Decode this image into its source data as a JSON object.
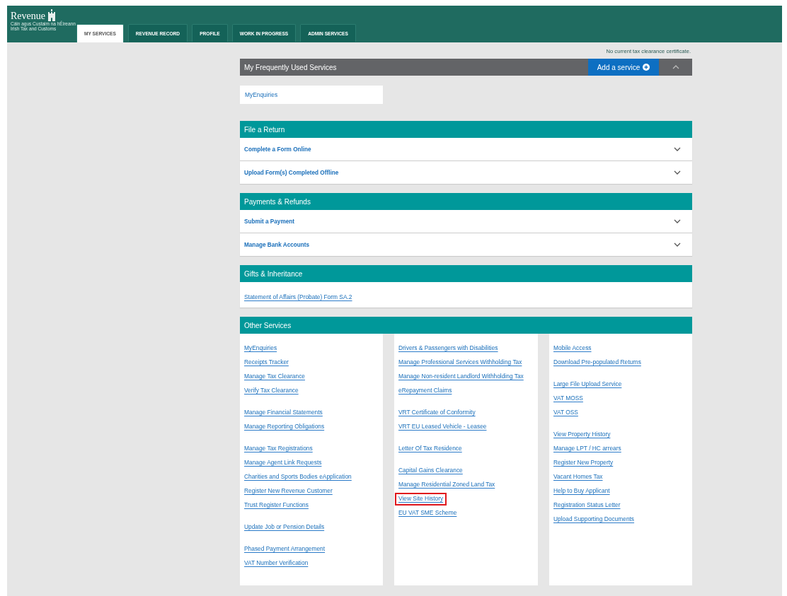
{
  "header": {
    "logo": {
      "name": "Revenue",
      "subtitle_1": "Cáin agus Custaim na hÉireann",
      "subtitle_2": "Irish Tax and Customs"
    },
    "tabs": [
      {
        "label": "MY SERVICES",
        "selected": true
      },
      {
        "label": "REVENUE RECORD",
        "selected": false
      },
      {
        "label": "PROFILE",
        "selected": false
      },
      {
        "label": "WORK IN PROGRESS",
        "selected": false
      },
      {
        "label": "ADMIN SERVICES",
        "selected": false
      }
    ]
  },
  "tax_clearance_notice": "No current tax clearance certificate.",
  "frequently_used": {
    "title": "My Frequently Used Services",
    "add_button": "Add a service",
    "expanded": true,
    "items": [
      "MyEnquiries"
    ]
  },
  "sections": [
    {
      "title": "File a Return",
      "kind": "accordion",
      "rows": [
        {
          "label": "Complete a Form Online",
          "expanded": false
        },
        {
          "label": "Upload Form(s) Completed Offline",
          "expanded": false
        }
      ]
    },
    {
      "title": "Payments & Refunds",
      "kind": "accordion",
      "rows": [
        {
          "label": "Submit a Payment",
          "expanded": false
        },
        {
          "label": "Manage Bank Accounts",
          "expanded": false
        }
      ]
    },
    {
      "title": "Gifts & Inheritance",
      "kind": "links",
      "links": [
        "Statement of Affairs (Probate) Form SA.2"
      ]
    }
  ],
  "other_services": {
    "title": "Other Services",
    "columns": [
      [
        [
          {
            "label": "MyEnquiries",
            "highlighted": false
          },
          {
            "label": "Receipts Tracker",
            "highlighted": false
          },
          {
            "label": "Manage Tax Clearance",
            "highlighted": false
          },
          {
            "label": "Verify Tax Clearance",
            "highlighted": false
          }
        ],
        [
          {
            "label": "Manage Financial Statements",
            "highlighted": false
          },
          {
            "label": "Manage Reporting Obligations",
            "highlighted": false
          }
        ],
        [
          {
            "label": "Manage Tax Registrations",
            "highlighted": false
          },
          {
            "label": "Manage Agent Link Requests",
            "highlighted": false
          },
          {
            "label": "Charities and Sports Bodies eApplication",
            "highlighted": false
          },
          {
            "label": "Register New Revenue Customer",
            "highlighted": false
          },
          {
            "label": "Trust Register Functions",
            "highlighted": false
          }
        ],
        [
          {
            "label": "Update Job or Pension Details",
            "highlighted": false
          }
        ],
        [
          {
            "label": "Phased Payment Arrangement",
            "highlighted": false
          },
          {
            "label": "VAT Number Verification",
            "highlighted": false
          }
        ]
      ],
      [
        [
          {
            "label": "Drivers & Passengers with Disabilities",
            "highlighted": false
          },
          {
            "label": "Manage Professional Services Withholding Tax",
            "highlighted": false
          },
          {
            "label": "Manage Non-resident Landlord Withholding Tax",
            "highlighted": false
          },
          {
            "label": "eRepayment Claims",
            "highlighted": false
          }
        ],
        [
          {
            "label": "VRT Certificate of Conformity",
            "highlighted": false
          },
          {
            "label": "VRT EU Leased Vehicle - Leasee",
            "highlighted": false
          }
        ],
        [
          {
            "label": "Letter Of Tax Residence",
            "highlighted": false
          }
        ],
        [
          {
            "label": "Capital Gains Clearance",
            "highlighted": false
          },
          {
            "label": "Manage Residential Zoned Land Tax",
            "highlighted": false
          },
          {
            "label": "View Site History",
            "highlighted": true
          },
          {
            "label": "EU VAT SME Scheme",
            "highlighted": false
          }
        ]
      ],
      [
        [
          {
            "label": "Mobile Access",
            "highlighted": false
          },
          {
            "label": "Download Pre-populated Returns",
            "highlighted": false
          }
        ],
        [
          {
            "label": "Large File Upload Service",
            "highlighted": false
          },
          {
            "label": "VAT MOSS",
            "highlighted": false
          },
          {
            "label": "VAT OSS",
            "highlighted": false
          }
        ],
        [
          {
            "label": "View Property History",
            "highlighted": false
          },
          {
            "label": "Manage LPT / HC arrears",
            "highlighted": false
          },
          {
            "label": "Register New Property",
            "highlighted": false
          },
          {
            "label": "Vacant Homes Tax",
            "highlighted": false
          },
          {
            "label": "Help to Buy Applicant",
            "highlighted": false
          },
          {
            "label": "Registration Status Letter",
            "highlighted": false
          },
          {
            "label": "Upload Supporting Documents",
            "highlighted": false
          }
        ]
      ]
    ]
  }
}
